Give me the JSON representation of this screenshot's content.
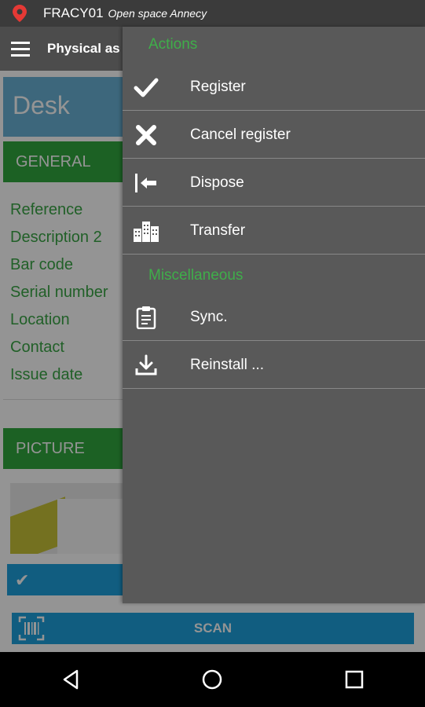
{
  "status": {
    "title": "FRACY01",
    "subtitle": "Open space Annecy"
  },
  "appbar": {
    "title": "Physical as"
  },
  "page": {
    "object_title": "Desk"
  },
  "sections": {
    "general": "GENERAL",
    "picture": "PICTURE"
  },
  "fields": [
    "Reference",
    "Description 2",
    "Bar code",
    "Serial number",
    "Location",
    "Contact",
    "Issue date"
  ],
  "scan": {
    "label": "SCAN"
  },
  "menu": {
    "actions_label": "Actions",
    "misc_label": "Miscellaneous",
    "items": [
      {
        "label": "Register",
        "icon": "check-icon"
      },
      {
        "label": "Cancel register",
        "icon": "close-icon"
      },
      {
        "label": "Dispose",
        "icon": "dispose-icon"
      },
      {
        "label": "Transfer",
        "icon": "buildings-icon"
      },
      {
        "label": "Sync.",
        "icon": "clipboard-icon"
      },
      {
        "label": "Reinstall ...",
        "icon": "download-icon"
      }
    ]
  },
  "colors": {
    "accent_green": "#31a83f",
    "accent_blue": "#1ea0dc",
    "pin_red": "#e53935"
  }
}
